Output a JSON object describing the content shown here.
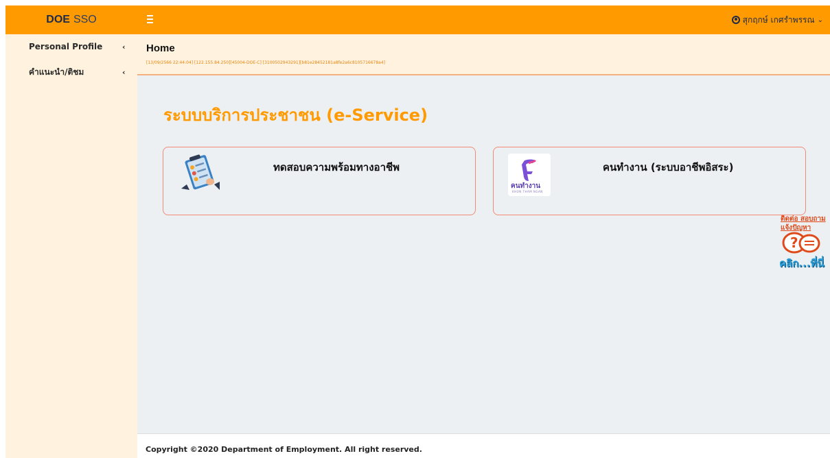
{
  "brand": {
    "bold": "DOE",
    "light": "SSO"
  },
  "header": {
    "menu_icon": "hamburger-icon",
    "user_icon": "user-circle-icon",
    "user_name": "สุกฤกษ์ เกศรำพรรณ",
    "user_chevron": "chevron-down-icon"
  },
  "sidebar": {
    "items": [
      {
        "label": "Personal Profile",
        "icon": "chevron-left-icon"
      },
      {
        "label": "คำแนะนำ/ติชม",
        "icon": "chevron-left-icon"
      }
    ]
  },
  "content_header": {
    "title": "Home",
    "session_info": "[13/09/2566 22:44:04] [122.155.84.250][45004-DOE-C] [3100502943291][b81e28452181a8fe2a6c8105716678a4]"
  },
  "main": {
    "title": "ระบบบริการประชาชน (e-Service)",
    "cards": [
      {
        "label": "ทดสอบความพร้อมทางอาชีพ",
        "icon": "job-readiness-icon"
      },
      {
        "label": "คนทำงาน (ระบบอาชีพอิสระ)",
        "icon": "khon-tham-ngan-logo",
        "logo_text": "คนทำงาน",
        "logo_subtext": "KHON THAM NGAN"
      }
    ]
  },
  "help_badge": {
    "line1": "ติดต่อ สอบถาม",
    "line2": "แจ้งปัญหา",
    "line3": "คลิก...ที่นี่",
    "icon": "question-chat-icon"
  },
  "footer": {
    "text": "Copyright ©2020 Department of Employment. All right reserved."
  },
  "colors": {
    "accent": "#ff9a00",
    "sidebar_bg": "#fff3df",
    "main_bg": "#edf0f3",
    "card_border": "#f08a74"
  }
}
